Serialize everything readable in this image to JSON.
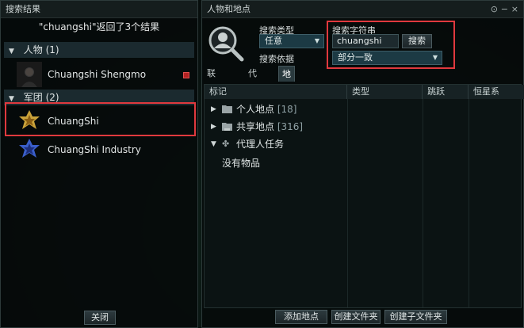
{
  "left_window": {
    "title": "搜索结果",
    "summary": "\"chuangshi\"返回了3个结果",
    "groups": [
      {
        "label": "人物 (1)",
        "items": [
          {
            "label": "Chuangshi Shengmo"
          }
        ]
      },
      {
        "label": "军团 (2)",
        "items": [
          {
            "label": "ChuangShi"
          },
          {
            "label": "ChuangShi Industry"
          }
        ]
      }
    ],
    "close_label": "关闭"
  },
  "right_window": {
    "title": "人物和地点",
    "search_type_label": "搜索类型",
    "search_type_value": "任意",
    "search_string_label": "搜索字符串",
    "search_input_value": "chuangshi",
    "search_button_label": "搜索",
    "search_basis_label": "搜索依据",
    "search_basis_value": "部分一致",
    "tabs": [
      {
        "label": "联系对象"
      },
      {
        "label": "代理人"
      },
      {
        "label": "地点"
      }
    ],
    "columns": [
      "标记",
      "类型",
      "跳跃",
      "恒星系"
    ],
    "folders": [
      {
        "name": "个人地点",
        "count": "[18]"
      },
      {
        "name": "共享地点",
        "count": "[316]"
      },
      {
        "name": "代理人任务",
        "count": ""
      }
    ],
    "empty_text": "没有物品",
    "buttons": {
      "add_location": "添加地点",
      "create_folder": "创建文件夹",
      "create_subfolder": "创建子文件夹"
    }
  },
  "colors": {
    "highlight": "#e0393e",
    "accent_blue": "#1c3a44"
  }
}
